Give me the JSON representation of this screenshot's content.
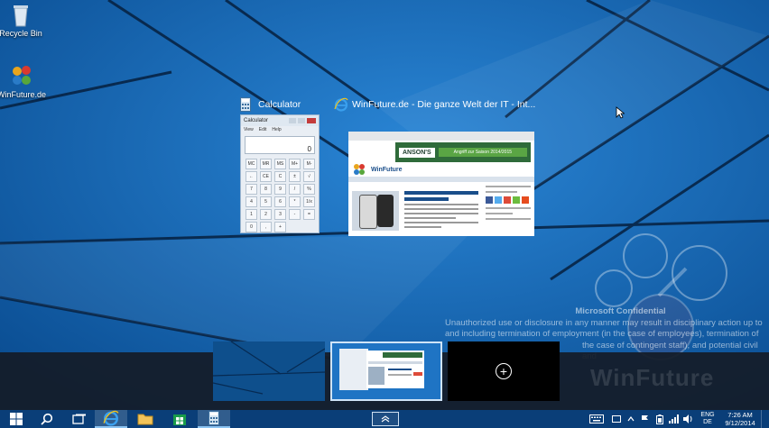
{
  "desktop": {
    "icons": [
      {
        "label": "Recycle Bin"
      },
      {
        "label": "WinFuture.de"
      }
    ]
  },
  "task_view": {
    "windows": [
      {
        "title": "Calculator"
      },
      {
        "title": "WinFuture.de - Die ganze Welt der IT - Int..."
      }
    ]
  },
  "calculator_thumb": {
    "window_title": "Calculator",
    "menu": [
      "View",
      "Edit",
      "Help"
    ],
    "display": "0",
    "keys": [
      "MC",
      "MR",
      "MS",
      "M+",
      "M-",
      "←",
      "CE",
      "C",
      "±",
      "√",
      "7",
      "8",
      "9",
      "/",
      "%",
      "4",
      "5",
      "6",
      "*",
      "1/x",
      "1",
      "2",
      "3",
      "-",
      "=",
      "0",
      ",",
      "+"
    ]
  },
  "ie_thumb": {
    "banner_brand": "ANSON'S",
    "banner_text": "Angriff zur Saison 2014/2015",
    "site_logo": "WinFuture"
  },
  "watermark": {
    "heading": "Microsoft Confidential",
    "lines": [
      "Unauthorized use or disclosure in any manner may result in disciplinary action up to",
      "and including termination of employment (in the case of employees), termination of",
      "the case of contingent staff), and potential civil and"
    ],
    "brand": "WinFuture"
  },
  "virtual_desktops": {
    "add_label": "+"
  },
  "taskbar": {
    "language_line1": "ENG",
    "language_line2": "DE",
    "time": "7:26 AM",
    "date": "9/12/2014"
  },
  "colors": {
    "wallpaper": "#0d5fa8",
    "taskbar": "#0a3e78",
    "accent": "#8cc4f2"
  }
}
